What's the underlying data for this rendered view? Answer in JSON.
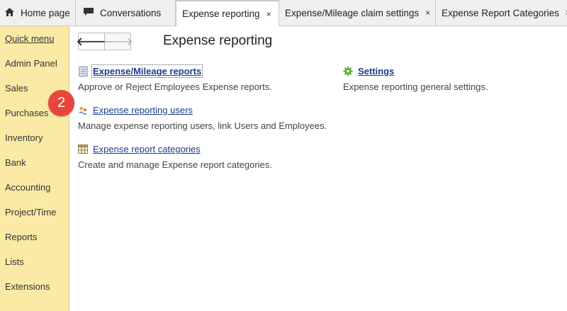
{
  "tabs": [
    {
      "label": "Home page",
      "icon": "home-icon"
    },
    {
      "label": "Conversations",
      "icon": "chat-icon"
    },
    {
      "label": "Expense reporting",
      "active": true,
      "closable": true
    },
    {
      "label": "Expense/Mileage claim settings",
      "closable": true
    },
    {
      "label": "Expense Report Categories",
      "closable": true
    }
  ],
  "tab_close_glyph": "×",
  "sidebar": {
    "items": [
      {
        "label": "Quick menu"
      },
      {
        "label": "Admin Panel"
      },
      {
        "label": "Sales"
      },
      {
        "label": "Purchases"
      },
      {
        "label": "Inventory"
      },
      {
        "label": "Bank"
      },
      {
        "label": "Accounting"
      },
      {
        "label": "Project/Time"
      },
      {
        "label": "Reports"
      },
      {
        "label": "Lists"
      },
      {
        "label": "Extensions"
      }
    ]
  },
  "nav": {
    "back": "🡐",
    "forward": "🡒"
  },
  "page_title": "Expense reporting",
  "sections": {
    "reports": {
      "label": "Expense/Mileage reports",
      "desc": "Approve or Reject Employees Expense reports.",
      "icon": "document-icon"
    },
    "settings": {
      "label": "Settings",
      "desc": "Expense reporting general settings.",
      "icon": "gear-icon"
    },
    "users": {
      "label": "Expense reporting users",
      "desc": "Manage expense reporting users, link Users and Employees.",
      "icon": "users-icon"
    },
    "categories": {
      "label": "Expense report categories",
      "desc": "Create and manage Expense report categories.",
      "icon": "table-icon"
    }
  },
  "annotation_badge": "2",
  "colors": {
    "sidebar_bg": "#fbeaa6",
    "link": "#1a3d8f",
    "badge": "#e8453c",
    "gear": "#5aa832"
  }
}
